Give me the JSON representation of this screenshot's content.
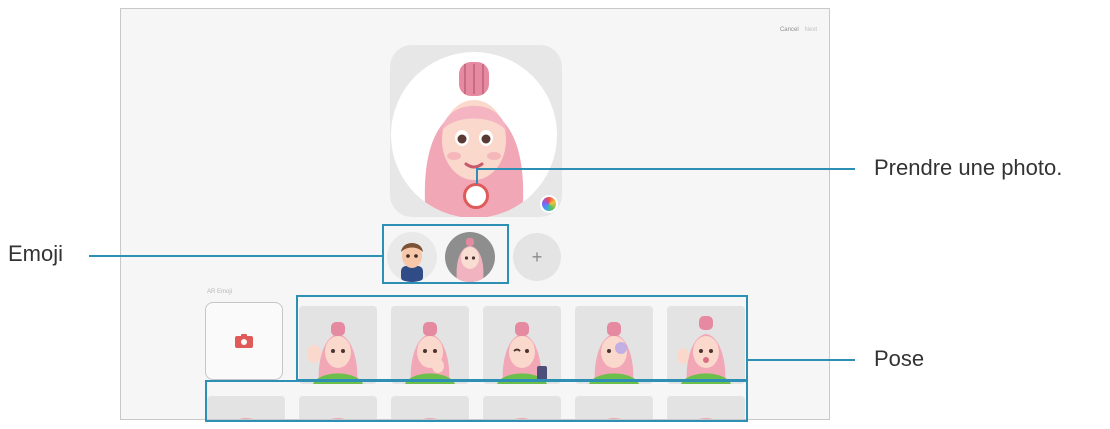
{
  "top_bar": {
    "cancel_label": "Cancel",
    "next_label": "Next"
  },
  "preview": {
    "color_wheel_icon": "color-palette-icon",
    "shutter_icon": "shutter-button"
  },
  "emoji_row": {
    "items": [
      {
        "name": "boy-avatar",
        "selected": false
      },
      {
        "name": "girl-avatar",
        "selected": true
      }
    ],
    "add_label": "+"
  },
  "poses": {
    "section_label": "AR Emoji",
    "camera_icon": "camera-icon",
    "tile_count_row1": 5,
    "tile_count_row2": 6
  },
  "callouts": {
    "photo": "Prendre une photo.",
    "emoji": "Emoji",
    "pose": "Pose"
  },
  "colors": {
    "callout": "#2c8fb3",
    "accent_red": "#e05a5a",
    "hair_pink": "#f2a7b6"
  }
}
